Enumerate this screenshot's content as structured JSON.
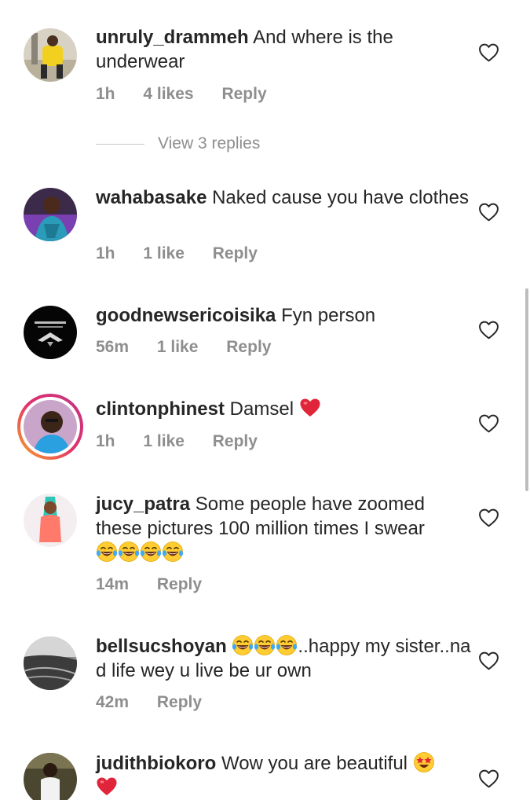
{
  "comments": [
    {
      "username": "unruly_drammeh",
      "text": "And where is the underwear",
      "time": "1h",
      "likes": "4 likes",
      "reply": "Reply",
      "replies_link": "View 3 replies"
    },
    {
      "username": "wahabasake",
      "text": "Naked cause you have clothes",
      "time": "1h",
      "likes": "1 like",
      "reply": "Reply"
    },
    {
      "username": "goodnewsericoisika",
      "text": "Fyn person",
      "time": "56m",
      "likes": "1 like",
      "reply": "Reply"
    },
    {
      "username": "clintonphinest",
      "text": "Damsel",
      "time": "1h",
      "likes": "1 like",
      "reply": "Reply"
    },
    {
      "username": "jucy_patra",
      "text": "Some people have zoomed these pictures 100 million times I swear",
      "time": "14m",
      "reply": "Reply"
    },
    {
      "username": "bellsucshoyan",
      "text": "..happy my sister..na d life wey u live be ur own",
      "time": "42m",
      "reply": "Reply"
    },
    {
      "username": "judithbiokoro",
      "text": "Wow you are beautiful"
    }
  ],
  "icons": {
    "like": "heart-outline-icon",
    "laugh": "tears-of-joy-emoji",
    "heart": "red-heart-emoji",
    "starstruck": "star-struck-emoji"
  },
  "colors": {
    "text": "#262626",
    "meta": "#8e8e8e",
    "heart": "#e0245e"
  }
}
